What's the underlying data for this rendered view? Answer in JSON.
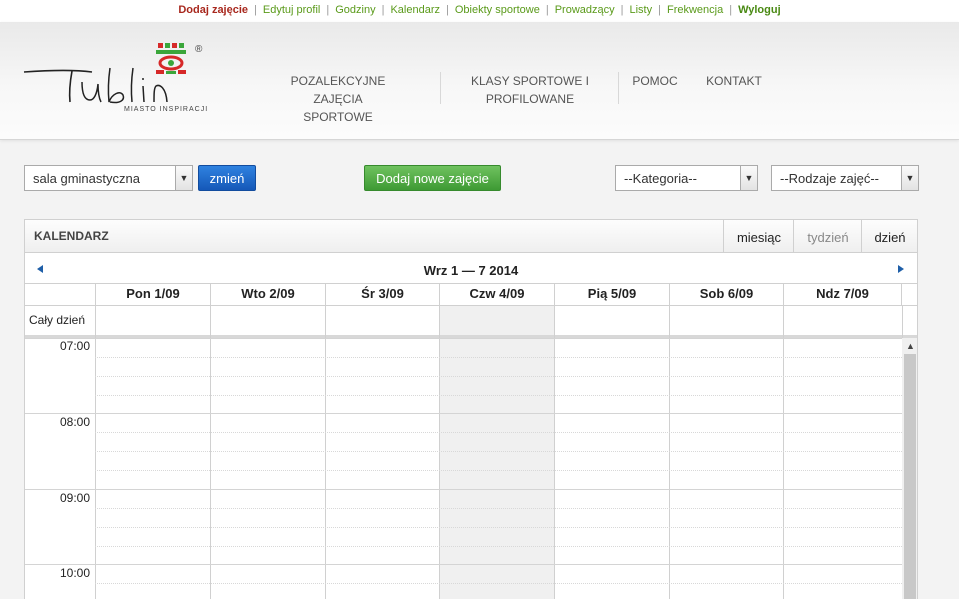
{
  "topnav": {
    "items": [
      {
        "label": "Dodaj zajęcie"
      },
      {
        "label": "Edytuj profil"
      },
      {
        "label": "Godziny"
      },
      {
        "label": "Kalendarz"
      },
      {
        "label": "Obiekty sportowe"
      },
      {
        "label": "Prowadzący"
      },
      {
        "label": "Listy"
      },
      {
        "label": "Frekwencja"
      },
      {
        "label": "Wyloguj"
      }
    ]
  },
  "logo": {
    "wordmark": "Lublin",
    "tagline": "MIASTO INSPIRACJI",
    "registered": "®"
  },
  "mainnav": {
    "items": [
      {
        "line1": "POZALEKCYJNE ZAJĘCIA",
        "line2": "SPORTOWE"
      },
      {
        "line1": "KLASY SPORTOWE I",
        "line2": "PROFILOWANE"
      },
      {
        "line1": "POMOC",
        "line2": ""
      },
      {
        "line1": "KONTAKT",
        "line2": ""
      }
    ]
  },
  "filters": {
    "venue": "sala gminastyczna",
    "change_label": "zmień",
    "add_label": "Dodaj nowe zajęcie",
    "category": "--Kategoria--",
    "types": "--Rodzaje zajęć--"
  },
  "calendar": {
    "title": "KALENDARZ",
    "views": {
      "month": "miesiąc",
      "week": "tydzień",
      "day": "dzień"
    },
    "range": "Wrz 1 — 7 2014",
    "days": [
      "Pon 1/09",
      "Wto 2/09",
      "Śr 3/09",
      "Czw 4/09",
      "Pią 5/09",
      "Sob 6/09",
      "Ndz 7/09"
    ],
    "allday_label": "Cały dzień",
    "hours": [
      "07:00",
      "08:00",
      "09:00",
      "10:00"
    ]
  },
  "colors": {
    "accent_green": "#5a9a1a",
    "active_red": "#a8281e",
    "button_blue": "#1a62c4",
    "button_green": "#4caf3f"
  }
}
